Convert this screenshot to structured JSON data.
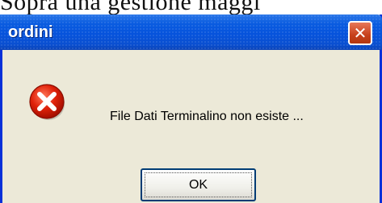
{
  "background_fragment": {
    "text": "Sopra una gestione maggi"
  },
  "dialog": {
    "title": "ordini",
    "close_glyph": "✕",
    "icon": "error-icon",
    "message": "File Dati Terminalino non esiste ...",
    "ok_label": "OK"
  },
  "colors": {
    "titlebar": "#0a5ce0",
    "window_border": "#0831d9",
    "client_bg": "#ece9d8",
    "close_button": "#c7401c",
    "error_red": "#d81e05"
  }
}
